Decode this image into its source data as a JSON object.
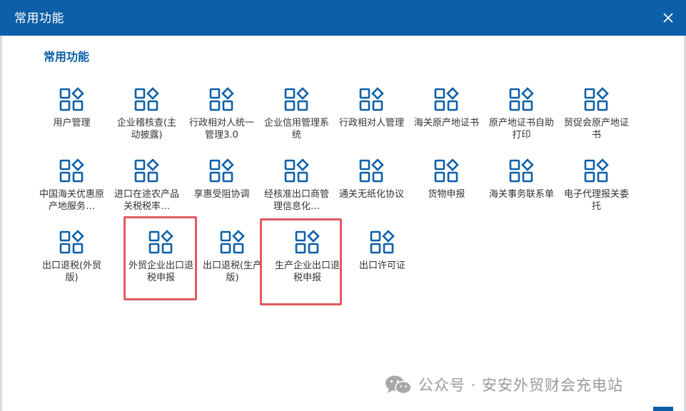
{
  "dialog": {
    "title": "常用功能"
  },
  "section": {
    "title": "常用功能"
  },
  "tiles": [
    {
      "label": "用户管理"
    },
    {
      "label": "企业稽核查(主动披露)"
    },
    {
      "label": "行政相对人统一管理3.0"
    },
    {
      "label": "企业信用管理系统"
    },
    {
      "label": "行政相对人管理"
    },
    {
      "label": "海关原产地证书"
    },
    {
      "label": "原产地证书自助打印"
    },
    {
      "label": "贸促会原产地证书"
    },
    {
      "label": "中国海关优惠原产地服务…"
    },
    {
      "label": "进口在途农产品关税税率…"
    },
    {
      "label": "享惠受阻协调"
    },
    {
      "label": "经核准出口商管理信息化…"
    },
    {
      "label": "通关无纸化协议"
    },
    {
      "label": "货物申报"
    },
    {
      "label": "海关事务联系单"
    },
    {
      "label": "电子代理报关委托"
    },
    {
      "label": "出口退税(外贸版)"
    },
    {
      "label": "外贸企业出口退税申报"
    },
    {
      "label": "出口退税(生产版)"
    },
    {
      "label": "生产企业出口退税申报"
    },
    {
      "label": "出口许可证"
    }
  ],
  "icons": {
    "tile": "apps-grid-icon",
    "close": "close-icon",
    "wechat": "wechat-icon"
  },
  "colors": {
    "header": "#0c5fa8",
    "icon": "#0c5fa8",
    "highlight": "#e15a5f"
  },
  "watermark": {
    "text": "公众号 · 安安外贸财会充电站"
  }
}
